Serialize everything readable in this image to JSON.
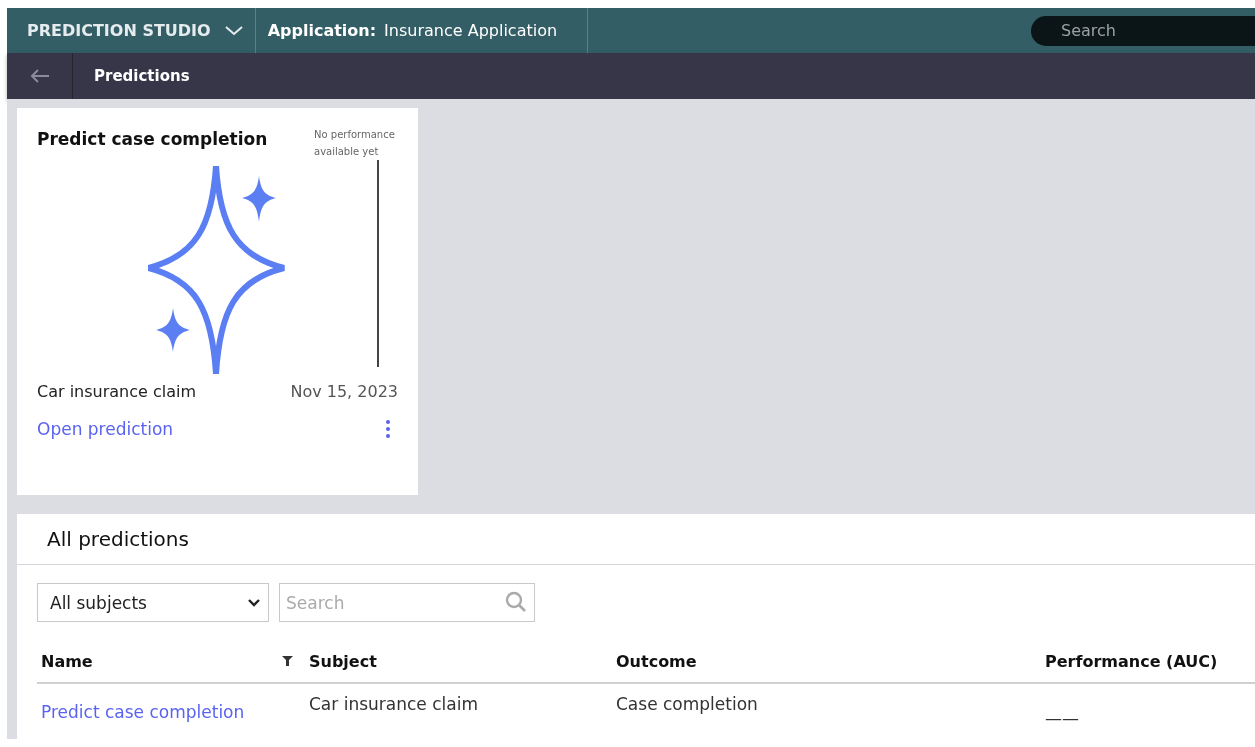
{
  "header": {
    "studio": "PREDICTION STUDIO",
    "application_label": "Application:",
    "application_name": "Insurance Application",
    "search": {
      "placeholder": "Search"
    }
  },
  "nav": {
    "title": "Predictions"
  },
  "card": {
    "title": "Predict case completion",
    "performance_note": "No performance available yet",
    "subject": "Car insurance claim",
    "date": "Nov 15, 2023",
    "link": "Open prediction"
  },
  "all_predictions": {
    "title": "All predictions",
    "subject_filter": {
      "value": "All subjects"
    },
    "search": {
      "placeholder": "Search"
    },
    "table": {
      "columns": [
        {
          "label": "Name",
          "filter": true
        },
        {
          "label": "Subject",
          "filter": false
        },
        {
          "label": "Outcome",
          "filter": false
        },
        {
          "label": "Performance (AUC)",
          "filter": false
        }
      ],
      "rows": [
        {
          "name": "Predict case completion",
          "subject": "Car insurance claim",
          "outcome": "Case completion",
          "performance": "——"
        }
      ]
    }
  }
}
